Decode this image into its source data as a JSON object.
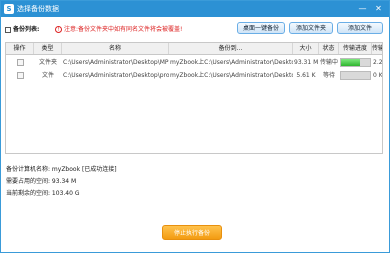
{
  "window": {
    "title": "选择备份数据",
    "minimize_glyph": "—",
    "close_glyph": "✕"
  },
  "toolbar": {
    "label": "备份列表:",
    "notice": "注意:备份文件夹中如有同名文件将会被覆盖!",
    "btn_desktop": "桌面一键备份",
    "btn_add_folder": "添加文件夹",
    "btn_add_file": "添加文件"
  },
  "table": {
    "columns": [
      "操作",
      "类型",
      "名称",
      "备份到...",
      "大小",
      "状态",
      "传输进度",
      "传输"
    ],
    "rows": [
      {
        "type": "文件夹",
        "name": "C:\\Users\\Administrator\\Desktop\\MP3",
        "dest": "myZbook上C:\\Users\\Administrator\\Desktop",
        "size": "93.31 M",
        "status": "传输中",
        "progress": 0.65,
        "speed": "2.23"
      },
      {
        "type": "文件",
        "name": "C:\\Users\\Administrator\\Desktop\\prod",
        "dest": "myZbook上C:\\Users\\Administrator\\Desktop",
        "size": "5.61 K",
        "status": "等待",
        "progress": 0,
        "speed": "0 K/s"
      }
    ]
  },
  "info": {
    "computer": "备份计算机名称: myZbook [已成功连接]",
    "needed": "需要占用的空间: 93.34 M",
    "remaining": "当前剩余的空间: 103.40 G"
  },
  "stop_button": "停止执行备份",
  "icons": {
    "logo": "app-logo-icon",
    "list": "list-icon",
    "warning": "warning-icon"
  },
  "colors": {
    "titlebar": "#2c91d4",
    "accent_orange": "#f39b12",
    "progress_green": "#2fb52f",
    "notice_red": "#d22222"
  }
}
